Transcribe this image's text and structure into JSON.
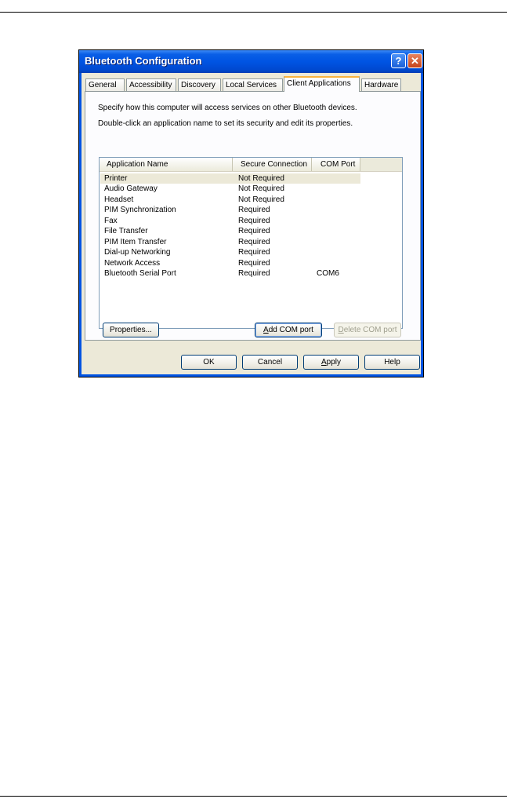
{
  "window": {
    "title": "Bluetooth Configuration",
    "help_glyph": "?",
    "close_glyph": "✕"
  },
  "tabs": [
    {
      "label": "General"
    },
    {
      "label": "Accessibility"
    },
    {
      "label": "Discovery"
    },
    {
      "label": "Local Services"
    },
    {
      "label": "Client Applications",
      "active": true
    },
    {
      "label": "Hardware"
    }
  ],
  "panel": {
    "description_1": "Specify how this computer will access services on other Bluetooth devices.",
    "description_2": "Double-click an application name to set its security and edit its properties."
  },
  "list": {
    "columns": [
      "Application Name",
      "Secure Connection",
      "COM Port"
    ],
    "rows": [
      {
        "name": "Printer",
        "secure": "Not Required",
        "port": "",
        "selected": true
      },
      {
        "name": "Audio Gateway",
        "secure": "Not Required",
        "port": ""
      },
      {
        "name": "Headset",
        "secure": "Not Required",
        "port": ""
      },
      {
        "name": "PIM Synchronization",
        "secure": "Required",
        "port": ""
      },
      {
        "name": "Fax",
        "secure": "Required",
        "port": ""
      },
      {
        "name": "File Transfer",
        "secure": "Required",
        "port": ""
      },
      {
        "name": "PIM Item Transfer",
        "secure": "Required",
        "port": ""
      },
      {
        "name": "Dial-up Networking",
        "secure": "Required",
        "port": ""
      },
      {
        "name": "Network Access",
        "secure": "Required",
        "port": ""
      },
      {
        "name": "Bluetooth Serial Port",
        "secure": "Required",
        "port": "COM6"
      }
    ]
  },
  "panel_buttons": {
    "properties": "Properties...",
    "add_com_port_key": "A",
    "add_com_port_rest": "dd COM port",
    "delete_com_port_key": "D",
    "delete_com_port_rest": "elete COM port"
  },
  "dialog_buttons": {
    "ok": "OK",
    "cancel": "Cancel",
    "apply_key": "A",
    "apply_rest": "pply",
    "help": "Help"
  }
}
